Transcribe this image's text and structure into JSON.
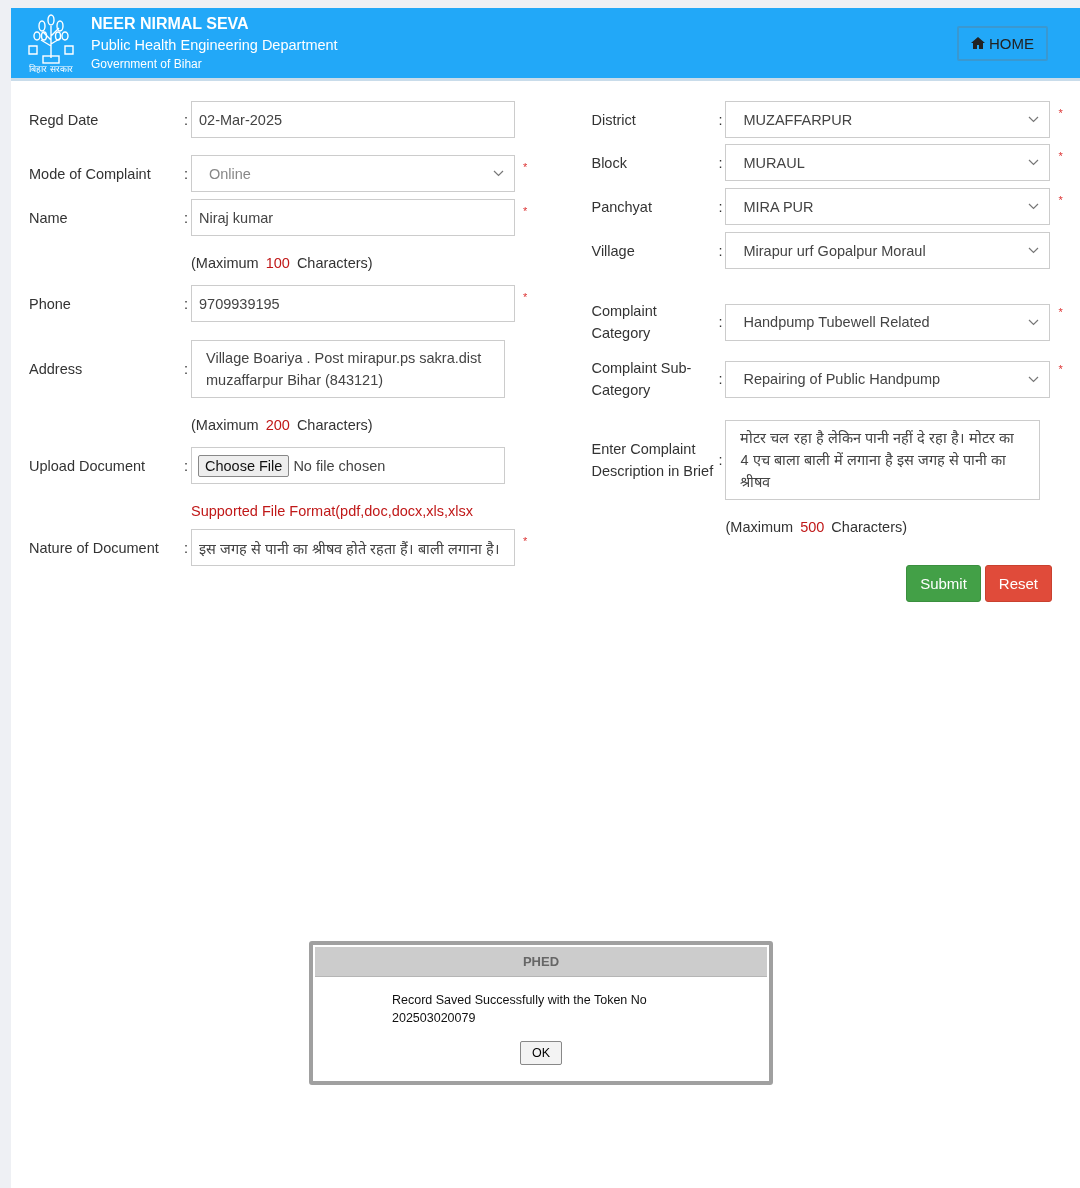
{
  "header": {
    "emblem_caption": "बिहार सरकार",
    "title": "NEER NIRMAL SEVA",
    "subtitle": "Public Health Engineering Department",
    "government": "Government of Bihar",
    "home_button": "HOME"
  },
  "left_fields": [
    {
      "kind": "input",
      "label": "Regd Date",
      "colon": ":",
      "value": "02-Mar-2025",
      "disabled": false
    },
    {
      "kind": "select",
      "label": "Mode of Complaint",
      "colon": ":",
      "value": "Online",
      "disabled": true,
      "required_mark": "*"
    },
    {
      "kind": "input",
      "label": "Name",
      "colon": ":",
      "value": "Niraj kumar",
      "disabled": false,
      "required_mark": "*",
      "hint": {
        "before": "(Maximum",
        "limit": "100",
        "after": "Characters)"
      }
    },
    {
      "kind": "input",
      "label": "Phone",
      "colon": ":",
      "value": "9709939195",
      "disabled": false,
      "required_mark": "*"
    },
    {
      "kind": "textarea",
      "label": "Address",
      "colon": ":",
      "value": "Village Boariya . Post mirapur.ps sakra.dist muzaffarpur Bihar (843121)",
      "disabled": false,
      "hint": {
        "before": "(Maximum",
        "limit": "200",
        "after": "Characters)"
      }
    },
    {
      "kind": "file",
      "label": "Upload Document",
      "colon": ":",
      "button": "Choose File",
      "status": "No file chosen",
      "disabled": false,
      "note": "Supported File Format(pdf,doc,docx,xls,xlsx"
    },
    {
      "kind": "input",
      "label": "Nature of Document",
      "colon": ":",
      "value": "इस जगह से पानी का श्रीषव होते रहता हैं। बाली लगाना है।",
      "disabled": false,
      "required_mark": "*"
    }
  ],
  "right_fields": [
    {
      "kind": "select",
      "label": "District",
      "colon": ":",
      "value": "MUZAFFARPUR",
      "disabled": false,
      "required_mark": "*"
    },
    {
      "kind": "select",
      "label": "Block",
      "colon": ":",
      "value": "MURAUL",
      "disabled": false,
      "required_mark": "*"
    },
    {
      "kind": "select",
      "label": "Panchyat",
      "colon": ":",
      "value": "MIRA PUR",
      "disabled": false,
      "required_mark": "*"
    },
    {
      "kind": "select",
      "label": "Village",
      "colon": ":",
      "value": "Mirapur urf Gopalpur Moraul",
      "disabled": false
    },
    {
      "kind": "select",
      "label": "Complaint Category",
      "colon": ":",
      "value": "Handpump Tubewell Related",
      "disabled": false,
      "required_mark": "*"
    },
    {
      "kind": "select",
      "label": "Complaint Sub-Category",
      "colon": ":",
      "value": "Repairing of Public Handpump",
      "disabled": false,
      "required_mark": "*"
    },
    {
      "kind": "textarea",
      "label": "Enter Complaint Description in Brief",
      "colon": ":",
      "value": "मोटर चल रहा है लेकिन पानी नहीं दे रहा है। मोटर का 4 एच बाला बाली में लगाना है इस जगह से पानी का श्रीषव",
      "disabled": false,
      "hint": {
        "before": "(Maximum",
        "limit": "500",
        "after": "Characters)"
      }
    }
  ],
  "buttons": [
    {
      "kind": "submit",
      "label": "Submit"
    },
    {
      "kind": "reset",
      "label": "Reset"
    }
  ],
  "dialog": {
    "title": "PHED",
    "message": "Record Saved Successfully with the Token No 202503020079",
    "button": "OK"
  }
}
